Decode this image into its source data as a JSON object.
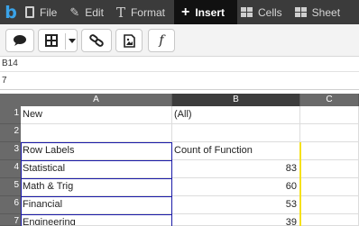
{
  "menubar": {
    "logo": "b",
    "tabs": [
      {
        "label": "File",
        "icon": "file-icon"
      },
      {
        "label": "Edit",
        "icon": "pencil-icon"
      },
      {
        "label": "Format",
        "icon": "text-format-icon"
      },
      {
        "label": "Insert",
        "icon": "plus-icon",
        "active": true
      },
      {
        "label": "Cells",
        "icon": "cells-grid-icon"
      },
      {
        "label": "Sheet",
        "icon": "sheet-icon"
      }
    ]
  },
  "toolbar": {
    "buttons": [
      "comment-icon",
      "table-icon",
      "link-icon",
      "image-icon",
      "function-icon"
    ],
    "function_glyph": "f"
  },
  "name_box": "B14",
  "formula_bar": "7",
  "columns": [
    "A",
    "B",
    "C"
  ],
  "rows": [
    {
      "num": "1",
      "a": "New",
      "b": "(All)"
    },
    {
      "num": "2",
      "a": "",
      "b": ""
    },
    {
      "num": "3",
      "a": "Row Labels",
      "b": "Count of Function"
    },
    {
      "num": "4",
      "a": "Statistical",
      "b": "83"
    },
    {
      "num": "5",
      "a": "Math & Trig",
      "b": "60"
    },
    {
      "num": "6",
      "a": "Financial",
      "b": "53"
    },
    {
      "num": "7",
      "a": "Engineering",
      "b": "39"
    }
  ],
  "colors": {
    "menubar": "#3b3b3b",
    "active_tab": "#111111",
    "logo": "#3aa3e8",
    "header": "#6a6a6a",
    "pivot_border": "#1a1aa8",
    "highlight": "#f5e11a"
  }
}
